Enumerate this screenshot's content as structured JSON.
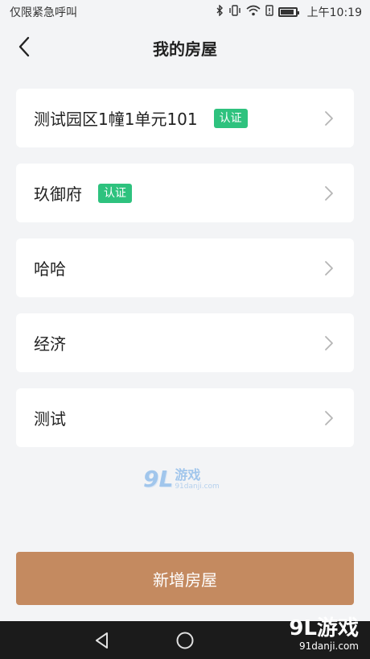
{
  "status_bar": {
    "left_text": "仅限紧急呼叫",
    "time": "上午10:19",
    "icons": [
      "bluetooth-icon",
      "vibrate-icon",
      "wifi-icon",
      "alert-icon",
      "battery-icon"
    ]
  },
  "header": {
    "title": "我的房屋",
    "back_icon": "chevron-left-icon"
  },
  "houses": [
    {
      "name": "测试园区1幢1单元101",
      "badge": "认证"
    },
    {
      "name": "玖御府",
      "badge": "认证"
    },
    {
      "name": "哈哈",
      "badge": ""
    },
    {
      "name": "经济",
      "badge": ""
    },
    {
      "name": "测试",
      "badge": ""
    }
  ],
  "watermark": {
    "logo": "9L",
    "title": "游戏",
    "url": "91danji.com"
  },
  "add_button": {
    "label": "新增房屋"
  },
  "corner_logo": {
    "main": "9L游戏",
    "url": "91danji.com"
  },
  "colors": {
    "background": "#f3f4f6",
    "badge": "#2ec27e",
    "add_button": "#c48a60",
    "system_nav": "#1b1b1b"
  }
}
